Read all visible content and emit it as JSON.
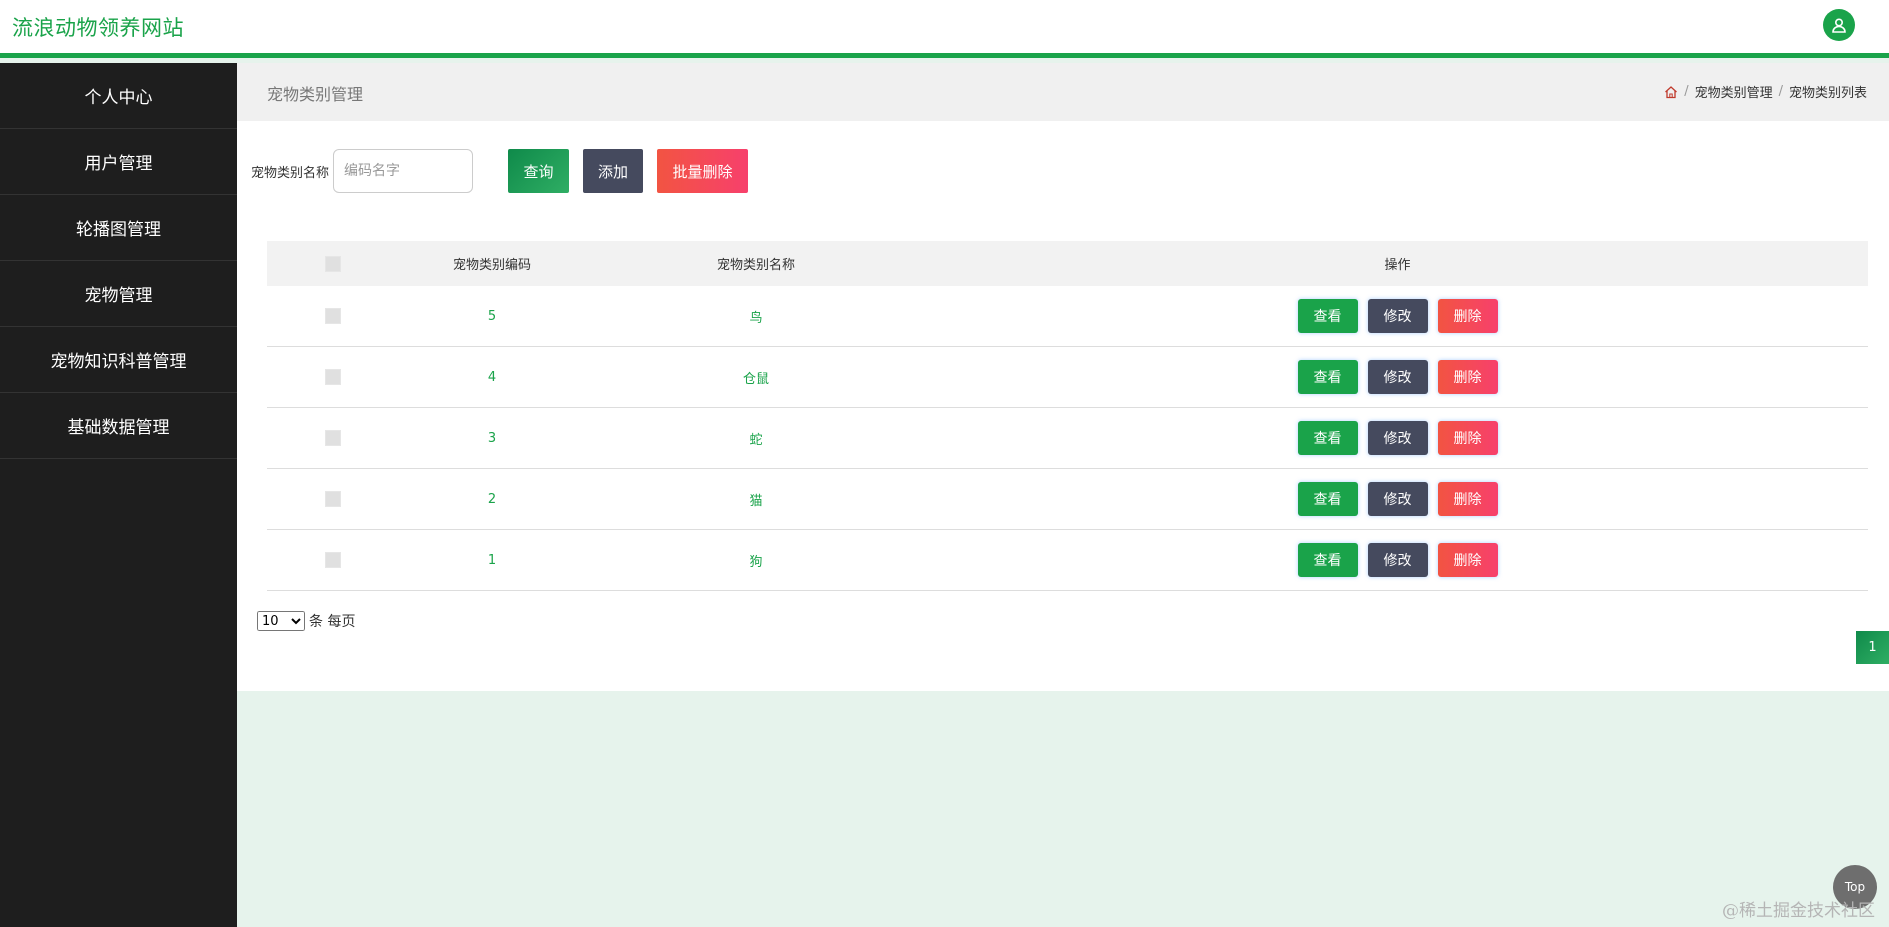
{
  "header": {
    "site_title": "流浪动物领养网站",
    "avatar_icon": "user-icon",
    "accent_color": "#1aa34a"
  },
  "sidebar": {
    "items": [
      {
        "label": "个人中心"
      },
      {
        "label": "用户管理"
      },
      {
        "label": "轮播图管理"
      },
      {
        "label": "宠物管理"
      },
      {
        "label": "宠物知识科普管理"
      },
      {
        "label": "基础数据管理"
      }
    ]
  },
  "page": {
    "title": "宠物类别管理",
    "breadcrumb": {
      "home_icon": "home-icon",
      "separator": "/",
      "level1": "宠物类别管理",
      "level2": "宠物类别列表"
    }
  },
  "search": {
    "label": "宠物类别名称",
    "placeholder": "编码名字",
    "value": "",
    "query_label": "查询",
    "add_label": "添加",
    "batch_delete_label": "批量删除"
  },
  "table": {
    "headers": {
      "code": "宠物类别编码",
      "name": "宠物类别名称",
      "operation": "操作"
    },
    "actions": {
      "view": "查看",
      "edit": "修改",
      "delete": "删除"
    },
    "rows": [
      {
        "code": "5",
        "name": "鸟"
      },
      {
        "code": "4",
        "name": "仓鼠"
      },
      {
        "code": "3",
        "name": "蛇"
      },
      {
        "code": "2",
        "name": "猫"
      },
      {
        "code": "1",
        "name": "狗"
      }
    ]
  },
  "pagination": {
    "page_size": "10",
    "page_size_suffix": "条 每页",
    "current_page": "1"
  },
  "back_to_top": "Top",
  "watermark": "@稀土掘金技术社区"
}
